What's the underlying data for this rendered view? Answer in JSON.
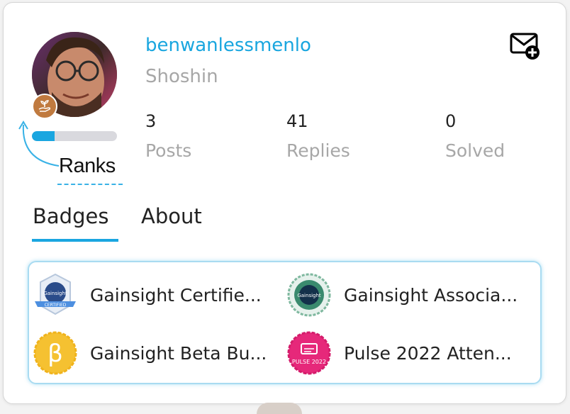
{
  "profile": {
    "username": "benwanlessmenlo",
    "rank_name": "Shoshin",
    "rank_progress": 0.27,
    "ranks_annotation": "Ranks"
  },
  "stats": [
    {
      "value": "3",
      "label": "Posts"
    },
    {
      "value": "41",
      "label": "Replies"
    },
    {
      "value": "0",
      "label": "Solved"
    }
  ],
  "tabs": [
    {
      "label": "Badges",
      "active": true
    },
    {
      "label": "About",
      "active": false
    }
  ],
  "badges": [
    {
      "title": "Gainsight Certifie...",
      "icon": "gainsight-certified-admin-icon",
      "color": "#3b7fd0"
    },
    {
      "title": "Gainsight Associa...",
      "icon": "gainsight-associate-admin-icon",
      "color": "#3a8a6e"
    },
    {
      "title": "Gainsight Beta Bu...",
      "icon": "beta-badge-icon",
      "color": "#f5c131"
    },
    {
      "title": "Pulse 2022 Atten...",
      "icon": "pulse-2022-icon",
      "color": "#e6287a"
    }
  ],
  "colors": {
    "accent": "#1aa6e0",
    "muted": "#a7a7a7"
  },
  "icons": {
    "message": "new-message-icon",
    "rank": "sprout-hand-icon"
  }
}
